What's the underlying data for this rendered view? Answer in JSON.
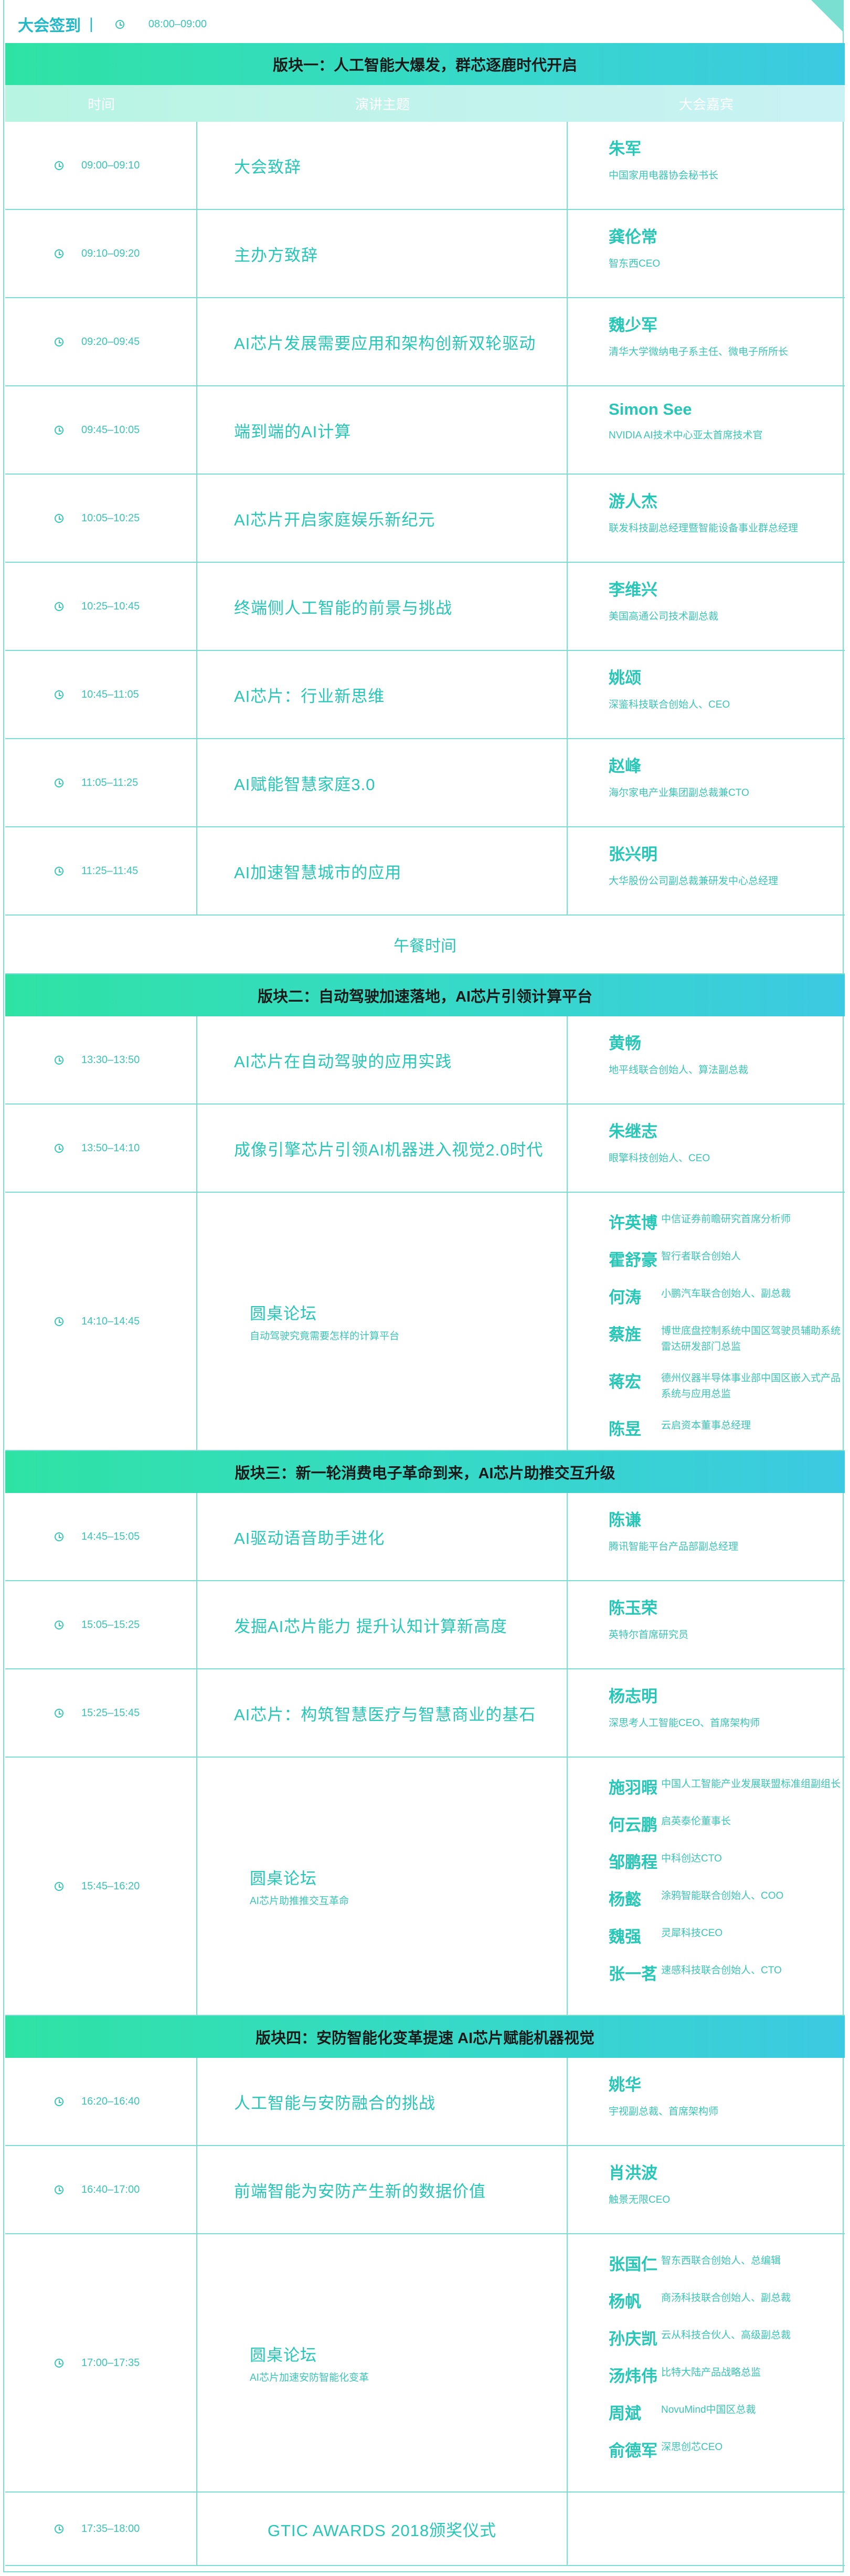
{
  "checkin": {
    "title": "大会签到",
    "divider": "|",
    "time": "08:00–09:00"
  },
  "columns": [
    "时间",
    "演讲主题",
    "大会嘉宾"
  ],
  "blocks": [
    {
      "title": "版块一：人工智能大爆发，群芯逐鹿时代开启"
    },
    {
      "title": "版块二：自动驾驶加速落地，AI芯片引领计算平台"
    },
    {
      "title": "版块三：新一轮消费电子革命到来，AI芯片助推交互升级"
    },
    {
      "title": "版块四：安防智能化变革提速 AI芯片赋能机器视觉"
    }
  ],
  "b1": [
    {
      "time": "09:00–09:10",
      "topic": "大会致辞",
      "name": "朱军",
      "title": "中国家用电器协会秘书长"
    },
    {
      "time": "09:10–09:20",
      "topic": "主办方致辞",
      "name": "龚伦常",
      "title": "智东西CEO"
    },
    {
      "time": "09:20–09:45",
      "topic": "AI芯片发展需要应用和架构创新双轮驱动",
      "name": "魏少军",
      "title": "清华大学微纳电子系主任、微电子所所长"
    },
    {
      "time": "09:45–10:05",
      "topic": "端到端的AI计算",
      "name": "Simon See",
      "title": "NVIDIA AI技术中心亚太首席技术官"
    },
    {
      "time": "10:05–10:25",
      "topic": "AI芯片开启家庭娱乐新纪元",
      "name": "游人杰",
      "title": "联发科技副总经理暨智能设备事业群总经理"
    },
    {
      "time": "10:25–10:45",
      "topic": "终端侧人工智能的前景与挑战",
      "name": "李维兴",
      "title": "美国高通公司技术副总裁"
    },
    {
      "time": "10:45–11:05",
      "topic": "AI芯片：行业新思维",
      "name": "姚颂",
      "title": "深鉴科技联合创始人、CEO"
    },
    {
      "time": "11:05–11:25",
      "topic": "AI赋能智慧家庭3.0",
      "name": "赵峰",
      "title": "海尔家电产业集团副总裁兼CTO"
    },
    {
      "time": "11:25–11:45",
      "topic": "AI加速智慧城市的应用",
      "name": "张兴明",
      "title": "大华股份公司副总裁兼研发中心总经理"
    }
  ],
  "lunch": "午餐时间",
  "b2": [
    {
      "time": "13:30–13:50",
      "topic": "AI芯片在自动驾驶的应用实践",
      "name": "黄畅",
      "title": "地平线联合创始人、算法副总裁"
    },
    {
      "time": "13:50–14:10",
      "topic": "成像引擎芯片引领AI机器进入视觉2.0时代",
      "name": "朱继志",
      "title": "眼擎科技创始人、CEO"
    }
  ],
  "rt1": {
    "time": "14:10–14:45",
    "title": "圆桌论坛",
    "sub": "自动驾驶究竟需要怎样的计算平台",
    "people": [
      {
        "name": "许英博",
        "title": "中信证券前瞻研究首席分析师"
      },
      {
        "name": "霍舒豪",
        "title": "智行者联合创始人"
      },
      {
        "name": "何涛",
        "title": "小鹏汽车联合创始人、副总裁"
      },
      {
        "name": "蔡旌",
        "title": "博世底盘控制系统中国区驾驶员辅助系统雷达研发部门总监"
      },
      {
        "name": "蒋宏",
        "title": "德州仪器半导体事业部中国区嵌入式产品系统与应用总监"
      },
      {
        "name": "陈昱",
        "title": "云启资本董事总经理"
      }
    ]
  },
  "b3": [
    {
      "time": "14:45–15:05",
      "topic": "AI驱动语音助手进化",
      "name": "陈谦",
      "title": "腾讯智能平台产品部副总经理"
    },
    {
      "time": "15:05–15:25",
      "topic": "发掘AI芯片能力 提升认知计算新高度",
      "name": "陈玉荣",
      "title": "英特尔首席研究员"
    },
    {
      "time": "15:25–15:45",
      "topic": "AI芯片：构筑智慧医疗与智慧商业的基石",
      "name": "杨志明",
      "title": "深思考人工智能CEO、首席架构师"
    }
  ],
  "rt2": {
    "time": "15:45–16:20",
    "title": "圆桌论坛",
    "sub": "AI芯片助推推交互革命",
    "people": [
      {
        "name": "施羽暇",
        "title": "中国人工智能产业发展联盟标准组副组长"
      },
      {
        "name": "何云鹏",
        "title": "启英泰伦董事长"
      },
      {
        "name": "邹鹏程",
        "title": "中科创达CTO"
      },
      {
        "name": "杨懿",
        "title": "涂鸦智能联合创始人、COO"
      },
      {
        "name": "魏强",
        "title": "灵犀科技CEO"
      },
      {
        "name": "张一茗",
        "title": "速感科技联合创始人、CTO"
      }
    ]
  },
  "b4": [
    {
      "time": "16:20–16:40",
      "topic": "人工智能与安防融合的挑战",
      "name": "姚华",
      "title": "宇视副总裁、首席架构师"
    },
    {
      "time": "16:40–17:00",
      "topic": "前端智能为安防产生新的数据价值",
      "name": "肖洪波",
      "title": "触景无限CEO"
    }
  ],
  "rt3": {
    "time": "17:00–17:35",
    "title": "圆桌论坛",
    "sub": "AI芯片加速安防智能化变革",
    "people": [
      {
        "name": "张国仁",
        "title": "智东西联合创始人、总编辑"
      },
      {
        "name": "杨帆",
        "title": "商汤科技联合创始人、副总裁"
      },
      {
        "name": "孙庆凯",
        "title": "云从科技合伙人、高级副总裁"
      },
      {
        "name": "汤炜伟",
        "title": "比特大陆产品战略总监"
      },
      {
        "name": "周斌",
        "title": "NovuMind中国区总裁"
      },
      {
        "name": "俞德军",
        "title": "深思创芯CEO"
      }
    ]
  },
  "final": {
    "time": "17:35–18:00",
    "topic": "GTIC AWARDS 2018颁奖仪式"
  }
}
